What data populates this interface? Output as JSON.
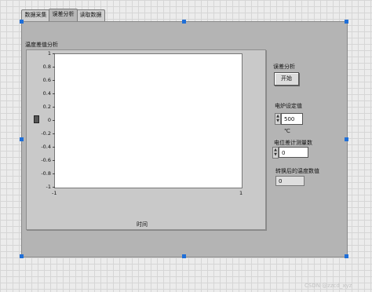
{
  "tabs": [
    {
      "label": "数据采集",
      "active": false
    },
    {
      "label": "误差分析",
      "active": true
    },
    {
      "label": "读取数据",
      "active": false
    }
  ],
  "chart": {
    "title": "温度差值分析",
    "ylabel_icon": "y-scale-icon",
    "xlabel": "时间",
    "yticks": [
      "1",
      "0.8",
      "0.6",
      "0.4",
      "0.2",
      "0",
      "-0.2",
      "-0.4",
      "-0.6",
      "-0.8",
      "-1"
    ],
    "xticks": [
      "-1",
      "1"
    ]
  },
  "chart_data": {
    "type": "line",
    "title": "温度差值分析",
    "xlabel": "时间",
    "ylabel": "",
    "xlim": [
      -1,
      1
    ],
    "ylim": [
      -1,
      1
    ],
    "series": []
  },
  "controls": {
    "error_label": "误差分析",
    "start_button": "开始",
    "furnace_label": "电炉设定值",
    "furnace_value": "500 ℃",
    "pot_label": "电位差计测量数",
    "pot_value": "0",
    "converted_label": "转换后的温度数值",
    "converted_value": "0"
  },
  "watermark": "CSDN @zzcd_xyz"
}
